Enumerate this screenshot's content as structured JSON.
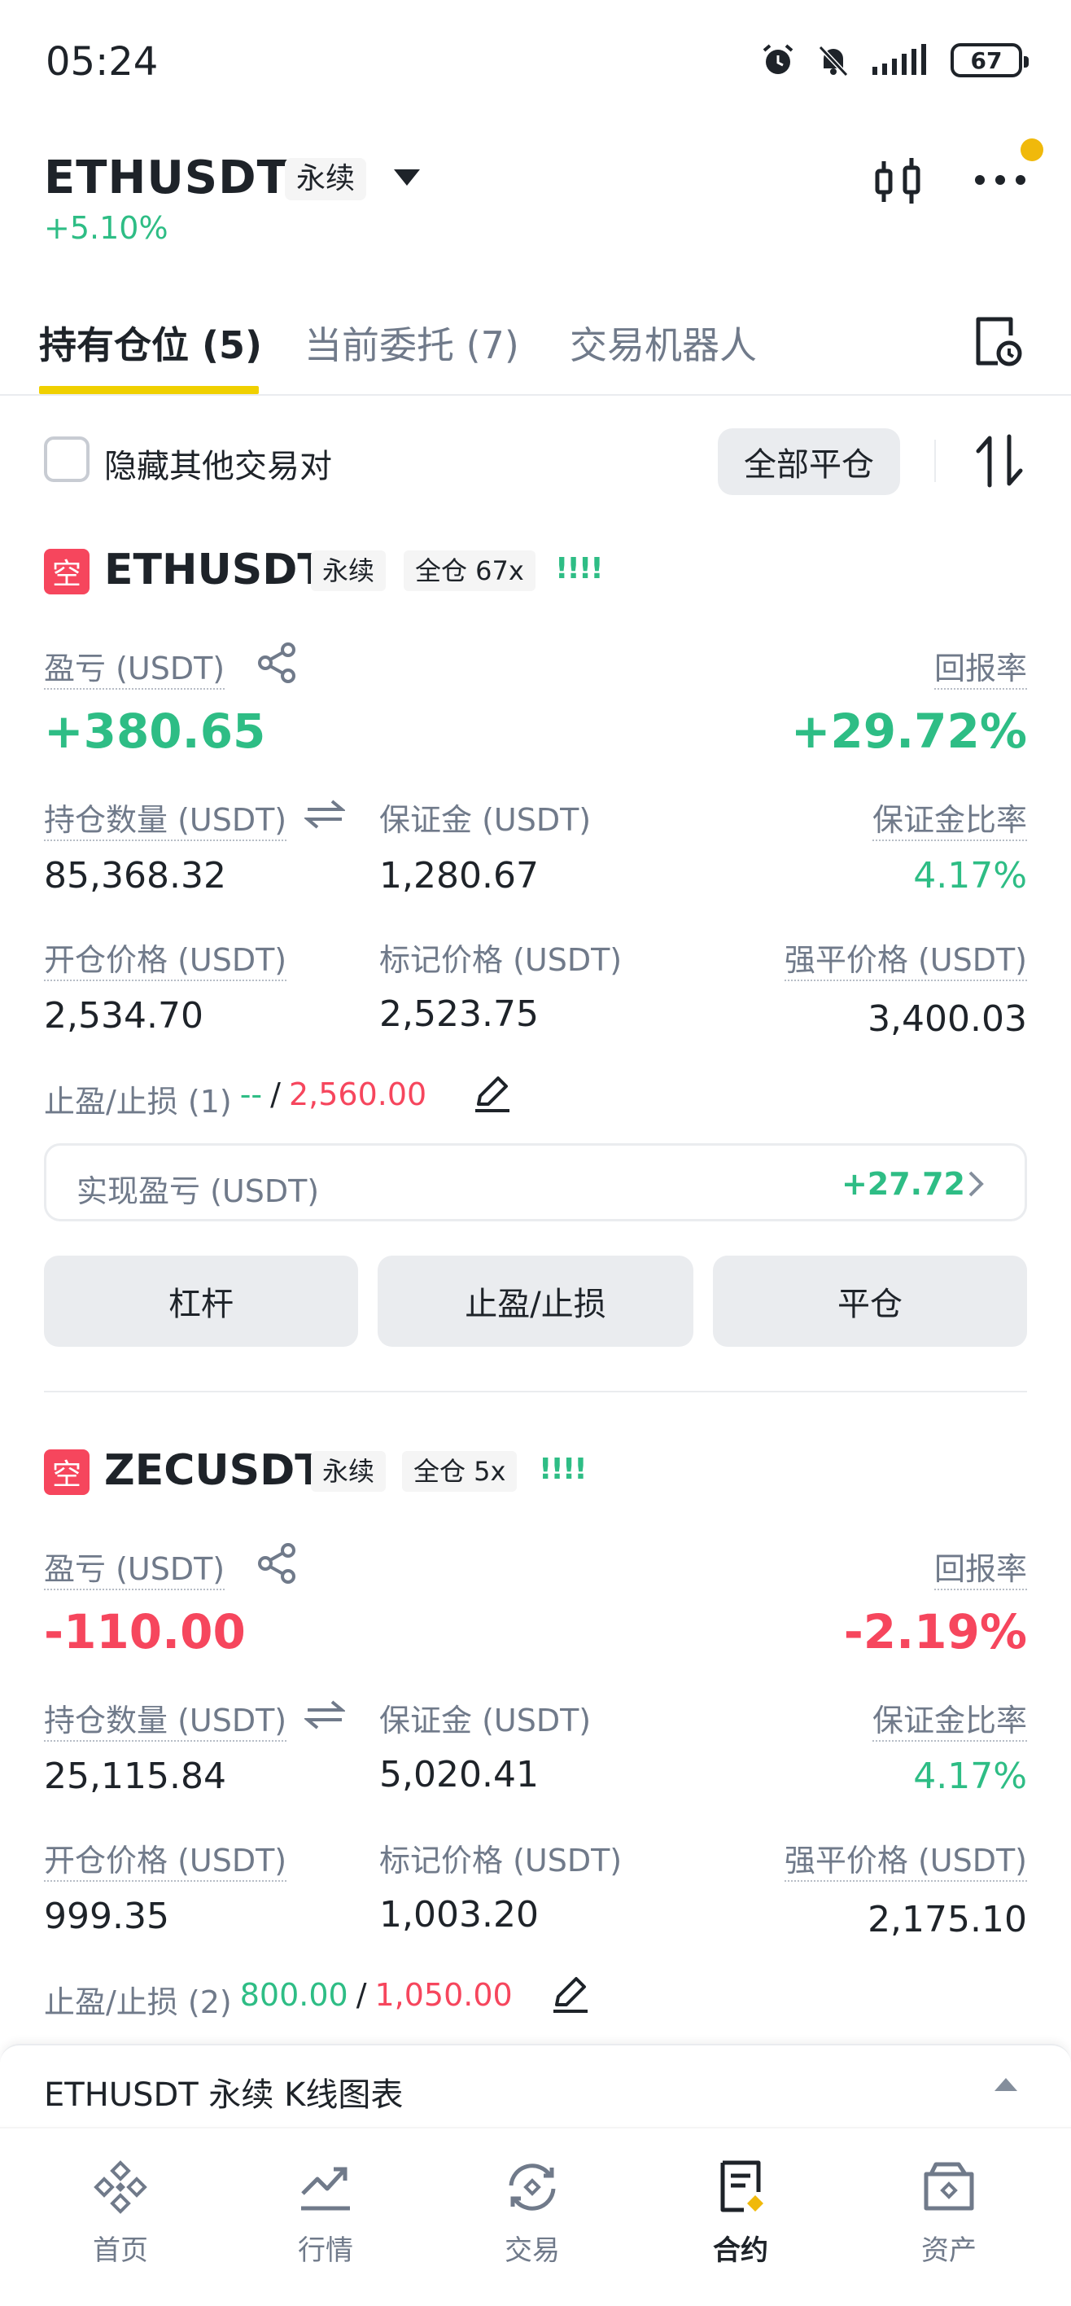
{
  "status": {
    "time": "05:24",
    "battery": "67"
  },
  "header": {
    "symbol": "ETHUSDT",
    "perp": "永续",
    "change": "+5.10%"
  },
  "tabs": [
    {
      "label": "持有仓位 (5)"
    },
    {
      "label": "当前委托 (7)"
    },
    {
      "label": "交易机器人"
    }
  ],
  "filter": {
    "hide_label": "隐藏其他交易对",
    "close_all": "全部平仓"
  },
  "labels": {
    "pnl": "盈亏 (USDT)",
    "roe": "回报率",
    "size": "持仓数量 (USDT)",
    "margin": "保证金 (USDT)",
    "margin_ratio": "保证金比率",
    "entry": "开仓价格 (USDT)",
    "mark": "标记价格 (USDT)",
    "liq": "强平价格 (USDT)",
    "realized": "实现盈亏 (USDT)",
    "leverage_btn": "杠杆",
    "tpsl_btn": "止盈/止损",
    "close_btn": "平仓",
    "short": "空"
  },
  "positions": [
    {
      "symbol": "ETHUSDT",
      "perp": "永续",
      "mode": "全仓 67x",
      "bars": "!!!!",
      "pnl": "+380.65",
      "roe": "+29.72%",
      "size": "85,368.32",
      "margin": "1,280.67",
      "margin_ratio": "4.17%",
      "entry": "2,534.70",
      "mark": "2,523.75",
      "liq": "3,400.03",
      "tpsl_label": "止盈/止损 (1)",
      "tp": "--",
      "sep": "/",
      "sl": "2,560.00",
      "realized": "+27.72"
    },
    {
      "symbol": "ZECUSDT",
      "perp": "永续",
      "mode": "全仓 5x",
      "bars": "!!!!",
      "pnl": "-110.00",
      "roe": "-2.19%",
      "size": "25,115.84",
      "margin": "5,020.41",
      "margin_ratio": "4.17%",
      "entry": "999.35",
      "mark": "1,003.20",
      "liq": "2,175.10",
      "tpsl_label": "止盈/止损 (2)",
      "tp": "800.00",
      "sep": "/",
      "sl": "1,050.00"
    }
  ],
  "kline": {
    "label": "ETHUSDT 永续 K线图表"
  },
  "nav": [
    {
      "label": "首页"
    },
    {
      "label": "行情"
    },
    {
      "label": "交易"
    },
    {
      "label": "合约"
    },
    {
      "label": "资产"
    }
  ],
  "colors": {
    "green": "#2ebd85",
    "red": "#f6465d",
    "brand": "#f0b90b"
  }
}
